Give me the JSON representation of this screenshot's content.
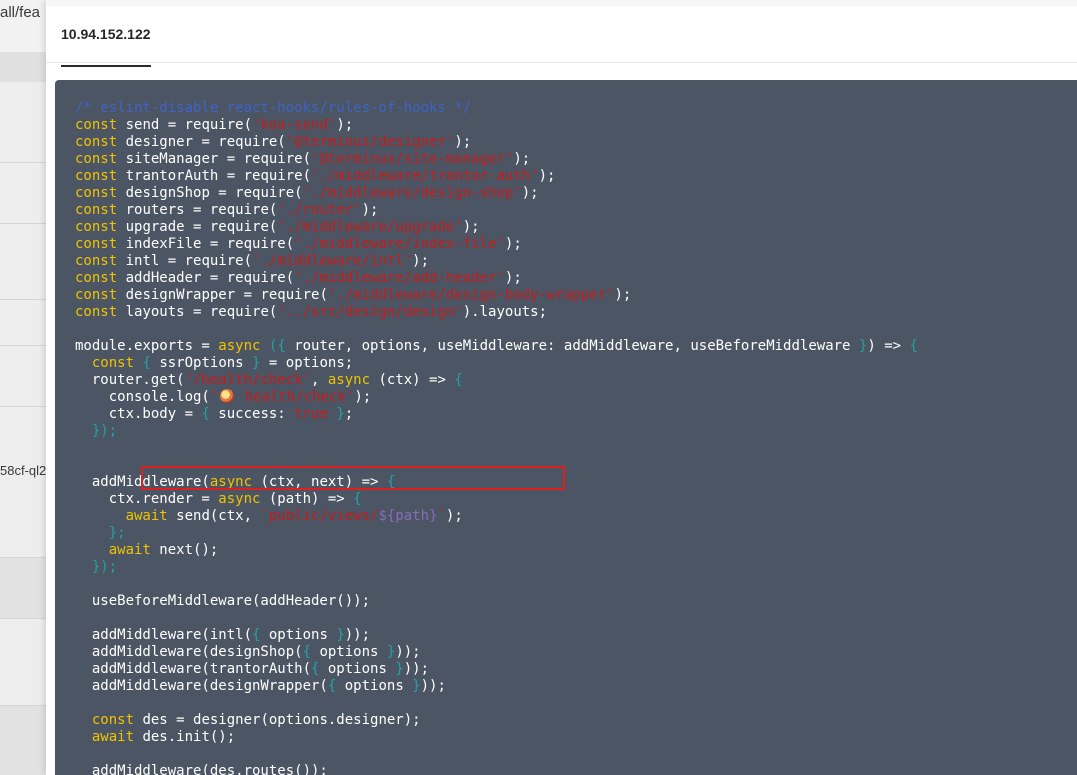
{
  "background_page": {
    "path_fragment": "all/fea",
    "id_fragment": "58cf-ql2"
  },
  "drawer": {
    "tab_label": "10.94.152.122"
  },
  "code": {
    "language": "javascript",
    "lines": [
      [
        {
          "t": "/* eslint-disable react-hooks/rules-of-hooks */",
          "c": "cmt"
        }
      ],
      [
        {
          "t": "const",
          "c": "kw"
        },
        {
          "t": " send = require("
        },
        {
          "t": "'koa-send'",
          "c": "str"
        },
        {
          "t": ");"
        }
      ],
      [
        {
          "t": "const",
          "c": "kw"
        },
        {
          "t": " designer = require("
        },
        {
          "t": "'@terminus/designer'",
          "c": "str"
        },
        {
          "t": ");"
        }
      ],
      [
        {
          "t": "const",
          "c": "kw"
        },
        {
          "t": " siteManager = require("
        },
        {
          "t": "'@terminus/site-manager'",
          "c": "str"
        },
        {
          "t": ");"
        }
      ],
      [
        {
          "t": "const",
          "c": "kw"
        },
        {
          "t": " trantorAuth = require("
        },
        {
          "t": "'./middleware/trantor-auth'",
          "c": "str"
        },
        {
          "t": ");"
        }
      ],
      [
        {
          "t": "const",
          "c": "kw"
        },
        {
          "t": " designShop = require("
        },
        {
          "t": "'./middleware/design-shop'",
          "c": "str"
        },
        {
          "t": ");"
        }
      ],
      [
        {
          "t": "const",
          "c": "kw"
        },
        {
          "t": " routers = require("
        },
        {
          "t": "'./router'",
          "c": "str"
        },
        {
          "t": ");"
        }
      ],
      [
        {
          "t": "const",
          "c": "kw"
        },
        {
          "t": " upgrade = require("
        },
        {
          "t": "'./middleware/upgrade'",
          "c": "str"
        },
        {
          "t": ");"
        }
      ],
      [
        {
          "t": "const",
          "c": "kw"
        },
        {
          "t": " indexFile = require("
        },
        {
          "t": "'./middleware/index-file'",
          "c": "str"
        },
        {
          "t": ");"
        }
      ],
      [
        {
          "t": "const",
          "c": "kw"
        },
        {
          "t": " intl = require("
        },
        {
          "t": "'./middleware/intl'",
          "c": "str"
        },
        {
          "t": ");"
        }
      ],
      [
        {
          "t": "const",
          "c": "kw"
        },
        {
          "t": " addHeader = require("
        },
        {
          "t": "'./middleware/add-header'",
          "c": "str"
        },
        {
          "t": ");"
        }
      ],
      [
        {
          "t": "const",
          "c": "kw"
        },
        {
          "t": " designWrapper = require("
        },
        {
          "t": "'./middleware/design-body-wrapper'",
          "c": "str"
        },
        {
          "t": ");"
        }
      ],
      [
        {
          "t": "const",
          "c": "kw"
        },
        {
          "t": " layouts = require("
        },
        {
          "t": "'../src/design/design'",
          "c": "str"
        },
        {
          "t": ").layouts;"
        }
      ],
      [],
      [
        {
          "t": "module.exports = "
        },
        {
          "t": "async",
          "c": "kw"
        },
        {
          "t": " "
        },
        {
          "t": "(",
          "c": "br"
        },
        {
          "t": "{",
          "c": "br"
        },
        {
          "t": " router, options, useMiddleware: addMiddleware, useBeforeMiddleware "
        },
        {
          "t": "}",
          "c": "br"
        },
        {
          "t": ") => "
        },
        {
          "t": "{",
          "c": "br"
        }
      ],
      [
        {
          "t": "  "
        },
        {
          "t": "const",
          "c": "kw"
        },
        {
          "t": " "
        },
        {
          "t": "{",
          "c": "br"
        },
        {
          "t": " ssrOptions "
        },
        {
          "t": "}",
          "c": "br"
        },
        {
          "t": " = options;"
        }
      ],
      [
        {
          "t": "  router.get("
        },
        {
          "t": "'/health/check'",
          "c": "str"
        },
        {
          "t": ", "
        },
        {
          "t": "async",
          "c": "kw"
        },
        {
          "t": " (ctx) => "
        },
        {
          "t": "{",
          "c": "br"
        }
      ],
      [
        {
          "t": "    console.log("
        },
        {
          "t": "'",
          "c": "str"
        },
        {
          "t": "EMOJI",
          "c": "emoji"
        },
        {
          "t": " health/check'",
          "c": "str"
        },
        {
          "t": ");"
        }
      ],
      [
        {
          "t": "    ctx.body = "
        },
        {
          "t": "{",
          "c": "br"
        },
        {
          "t": " success: "
        },
        {
          "t": "true",
          "c": "str"
        },
        {
          "t": " "
        },
        {
          "t": "}",
          "c": "br"
        },
        {
          "t": ";"
        }
      ],
      [
        {
          "t": "  "
        },
        {
          "t": "});",
          "c": "br"
        }
      ],
      [],
      [],
      [
        {
          "t": "  addMiddleware("
        },
        {
          "t": "async",
          "c": "kw"
        },
        {
          "t": " (ctx, next) => "
        },
        {
          "t": "{",
          "c": "br"
        }
      ],
      [
        {
          "t": "    ctx.render = "
        },
        {
          "t": "async",
          "c": "kw"
        },
        {
          "t": " (path) => "
        },
        {
          "t": "{",
          "c": "br"
        }
      ],
      [
        {
          "t": "      "
        },
        {
          "t": "await",
          "c": "kw"
        },
        {
          "t": " send(ctx, "
        },
        {
          "t": "`public/views/",
          "c": "str"
        },
        {
          "t": "${path}",
          "c": "tpl"
        },
        {
          "t": "`",
          "c": "str"
        },
        {
          "t": ");"
        }
      ],
      [
        {
          "t": "    "
        },
        {
          "t": "};",
          "c": "br"
        }
      ],
      [
        {
          "t": "    "
        },
        {
          "t": "await",
          "c": "kw"
        },
        {
          "t": " next();"
        }
      ],
      [
        {
          "t": "  "
        },
        {
          "t": "});",
          "c": "br"
        }
      ],
      [],
      [
        {
          "t": "  useBeforeMiddleware(addHeader());"
        }
      ],
      [],
      [
        {
          "t": "  addMiddleware(intl("
        },
        {
          "t": "{",
          "c": "br"
        },
        {
          "t": " options "
        },
        {
          "t": "}",
          "c": "br"
        },
        {
          "t": "));"
        }
      ],
      [
        {
          "t": "  addMiddleware(designShop("
        },
        {
          "t": "{",
          "c": "br"
        },
        {
          "t": " options "
        },
        {
          "t": "}",
          "c": "br"
        },
        {
          "t": "));"
        }
      ],
      [
        {
          "t": "  addMiddleware(trantorAuth("
        },
        {
          "t": "{",
          "c": "br"
        },
        {
          "t": " options "
        },
        {
          "t": "}",
          "c": "br"
        },
        {
          "t": "));"
        }
      ],
      [
        {
          "t": "  addMiddleware(designWrapper("
        },
        {
          "t": "{",
          "c": "br"
        },
        {
          "t": " options "
        },
        {
          "t": "}",
          "c": "br"
        },
        {
          "t": "));"
        }
      ],
      [],
      [
        {
          "t": "  "
        },
        {
          "t": "const",
          "c": "kw"
        },
        {
          "t": " des = designer(options.designer);"
        }
      ],
      [
        {
          "t": "  "
        },
        {
          "t": "await",
          "c": "kw"
        },
        {
          "t": " des.init();"
        }
      ],
      [],
      [
        {
          "t": "  addMiddleware(des.routes());"
        }
      ]
    ],
    "colors": {
      "background": "#4b5563",
      "keyword": "#f0c400",
      "string": "#c41d1d",
      "comment": "#3f63c7",
      "bracket": "#21a3a3",
      "template_var": "#8a6bb8",
      "default": "#ffffff"
    }
  },
  "annotation": {
    "highlight_color": "#e02020",
    "target": "console.log line"
  }
}
